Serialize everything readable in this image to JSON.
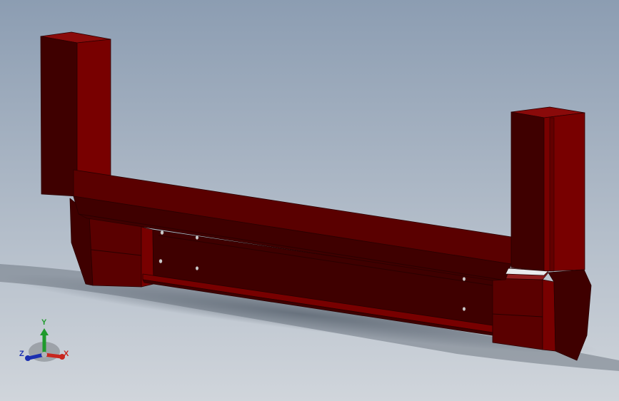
{
  "viewport": {
    "background_top": "#8c9db2",
    "background_bottom": "#d0d5db"
  },
  "model": {
    "face_dark": "#3f0000",
    "face_mid": "#5a0000",
    "face_bright": "#780000",
    "face_top": "#8a0a0a"
  },
  "triad": {
    "x_label": "X",
    "y_label": "Y",
    "z_label": "Z",
    "x_color": "#c8261e",
    "y_color": "#1f9a2c",
    "z_color": "#1b2fb0"
  }
}
